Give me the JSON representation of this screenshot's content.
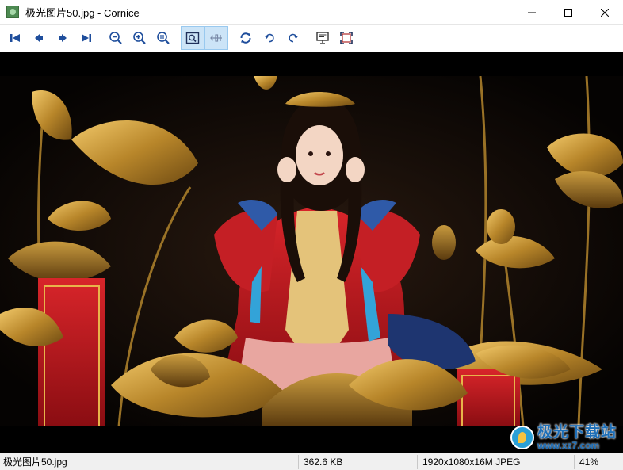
{
  "window": {
    "title": "极光图片50.jpg - Cornice",
    "controls": [
      "minimize",
      "maximize",
      "close"
    ]
  },
  "toolbar": {
    "buttons": [
      {
        "name": "first-image",
        "icon": "skip-first-icon"
      },
      {
        "name": "previous-image",
        "icon": "arrow-left-icon"
      },
      {
        "name": "next-image",
        "icon": "arrow-right-icon"
      },
      {
        "name": "last-image",
        "icon": "skip-last-icon"
      },
      {
        "name": "zoom-out",
        "icon": "zoom-out-icon"
      },
      {
        "name": "zoom-in",
        "icon": "zoom-in-icon"
      },
      {
        "name": "zoom-original",
        "icon": "zoom-1to1-icon"
      },
      {
        "name": "fit-to-window",
        "icon": "fit-window-icon",
        "active": true
      },
      {
        "name": "fit-width",
        "icon": "fit-width-icon",
        "active": true
      },
      {
        "name": "rotate",
        "icon": "rotate-icon"
      },
      {
        "name": "rotate-left",
        "icon": "undo-icon"
      },
      {
        "name": "rotate-right",
        "icon": "redo-icon"
      },
      {
        "name": "slideshow",
        "icon": "slideshow-icon"
      },
      {
        "name": "fullscreen",
        "icon": "fullscreen-icon"
      }
    ]
  },
  "viewer": {
    "image_description": "photo"
  },
  "watermark": {
    "text_cn": "极光下载站",
    "url": "www.xz7.com"
  },
  "statusbar": {
    "filename": "极光图片50.jpg",
    "filesize": "362.6 KB",
    "info": "1920x1080x16M JPEG",
    "zoom": "41%"
  },
  "colors": {
    "toolbar_icon": "#1f4e9c",
    "active_button_bg": "#cce4f7",
    "viewer_bg": "#000000"
  }
}
